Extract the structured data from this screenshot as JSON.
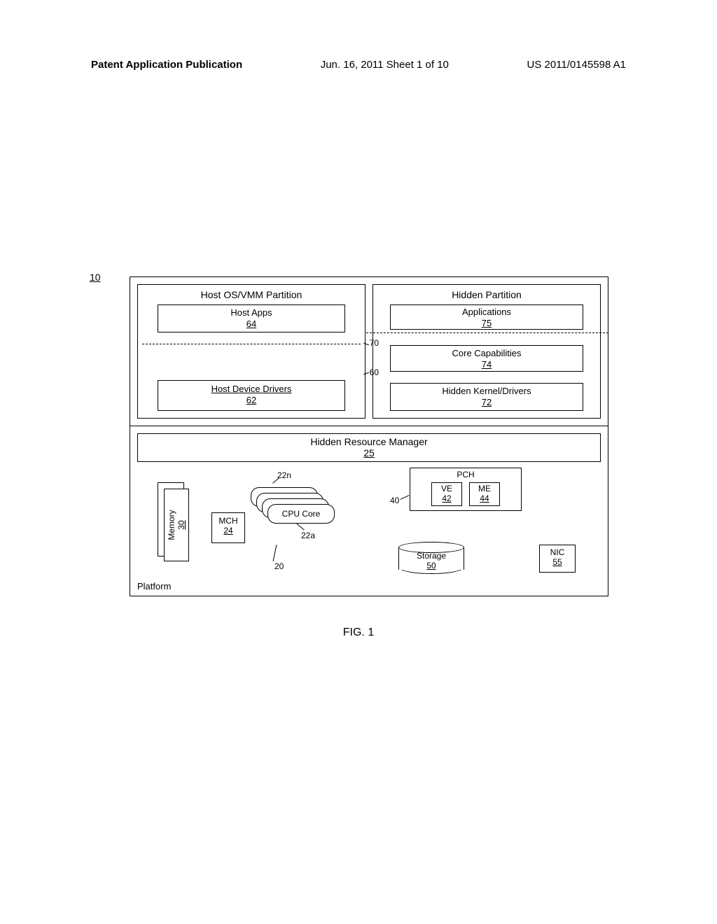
{
  "header": {
    "left": "Patent Application Publication",
    "middle": "Jun. 16, 2011  Sheet 1 of 10",
    "right": "US 2011/0145598 A1"
  },
  "diagram": {
    "ref10": "10",
    "hostPartition": {
      "title": "Host OS/VMM Partition",
      "hostApps": {
        "label": "Host Apps",
        "ref": "64"
      },
      "hostDrivers": {
        "label": "Host Device Drivers",
        "ref": "62"
      },
      "ref60": "60",
      "ref70": "70"
    },
    "hiddenPartition": {
      "title": "Hidden Partition",
      "apps": {
        "label": "Applications",
        "ref": "75"
      },
      "core": {
        "label": "Core Capabilities",
        "ref": "74"
      },
      "kernel": {
        "label": "Hidden Kernel/Drivers",
        "ref": "72"
      }
    },
    "hrm": {
      "label": "Hidden Resource Manager",
      "ref": "25"
    },
    "memory": {
      "label": "Memory",
      "ref": "30"
    },
    "mch": {
      "label": "MCH",
      "ref": "24"
    },
    "cpu": {
      "label": "CPU Core",
      "ref22a": "22a",
      "ref22n": "22n",
      "ref20": "20"
    },
    "pch": {
      "label": "PCH",
      "ve": {
        "label": "VE",
        "ref": "42"
      },
      "me": {
        "label": "ME",
        "ref": "44"
      },
      "ref40": "40"
    },
    "storage": {
      "label": "Storage",
      "ref": "50"
    },
    "nic": {
      "label": "NIC",
      "ref": "55"
    },
    "platformLabel": "Platform"
  },
  "caption": "FIG. 1"
}
